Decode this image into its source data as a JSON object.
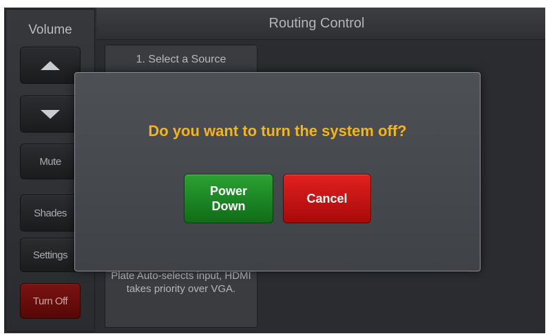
{
  "sidebar": {
    "title": "Volume",
    "buttons": {
      "mute": "Mute",
      "shades": "Shades",
      "settings": "Settings",
      "turn_off": "Turn Off"
    }
  },
  "header": {
    "title": "Routing Control"
  },
  "source_panel": {
    "title": "1. Select a Source",
    "note": "Plate Auto-selects input, HDMI takes priority over VGA."
  },
  "dialog": {
    "question": "Do you want to turn the system off?",
    "power_down_label": "Power\nDown",
    "cancel_label": "Cancel"
  },
  "colors": {
    "question_text": "#f3b51a",
    "power_down_bg": "#1a8a22",
    "cancel_bg": "#c81414",
    "turn_off_bg": "#6a0e0c"
  },
  "icons": [
    "volume-up-icon",
    "volume-down-icon"
  ]
}
